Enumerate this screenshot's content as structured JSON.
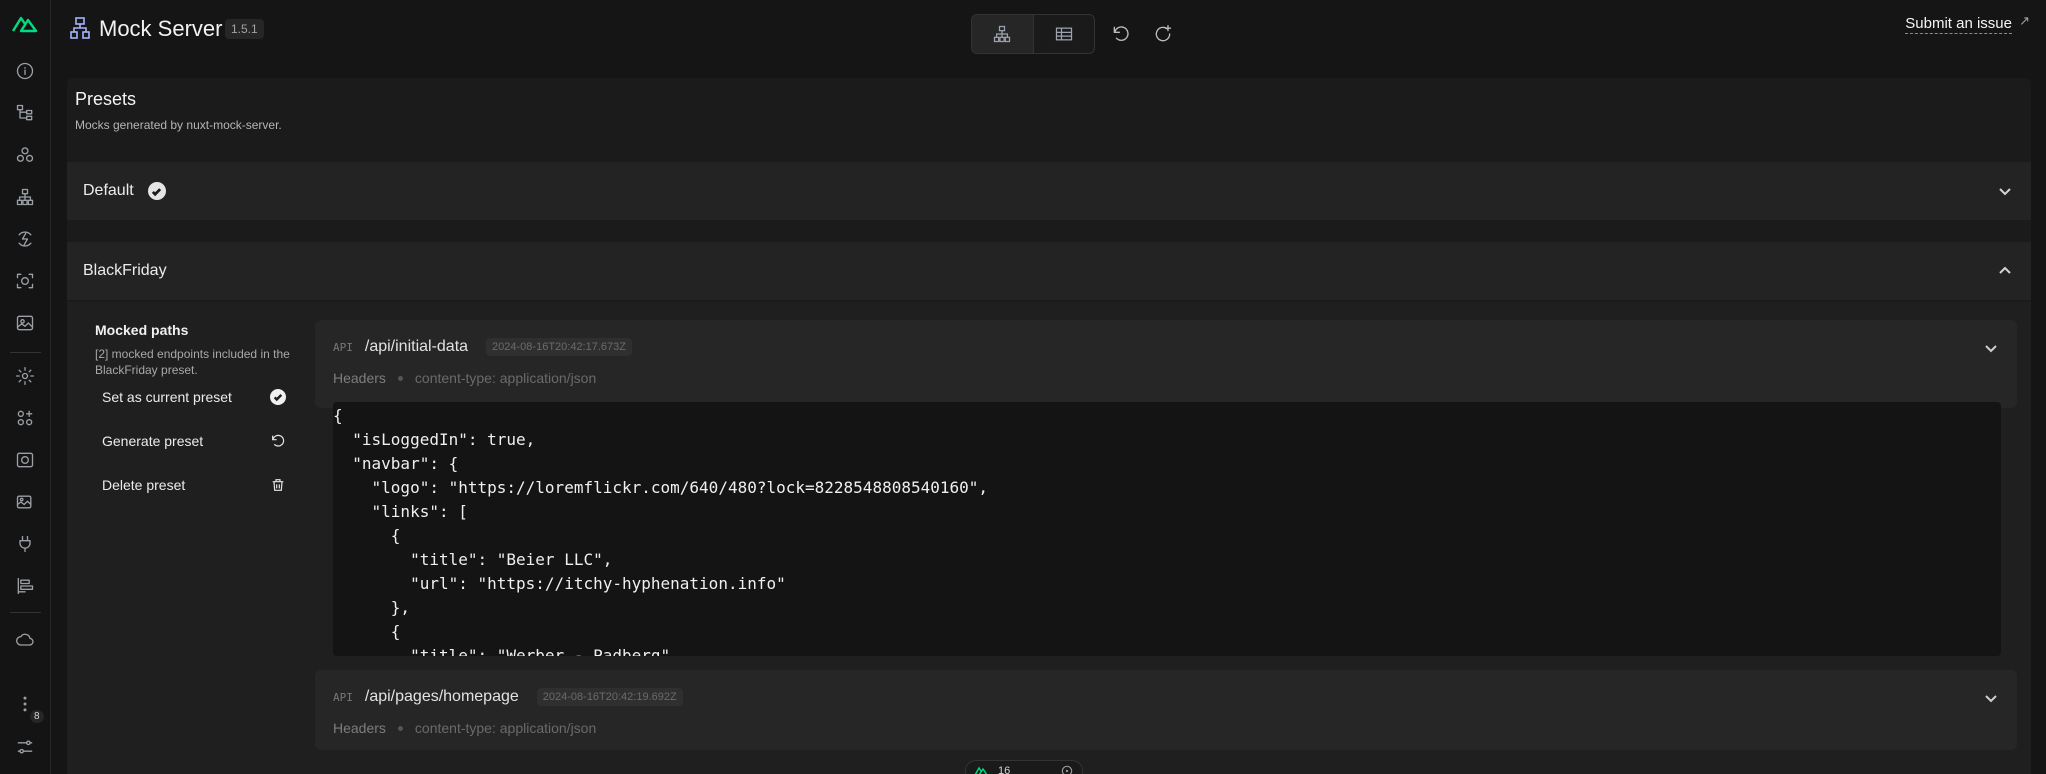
{
  "app": {
    "title": "Mock Server",
    "version": "1.5.1",
    "submit_issue_label": "Submit an issue",
    "brand_color": "#00dc82"
  },
  "sidebar": {
    "notification_count": "8"
  },
  "page": {
    "title": "Presets",
    "subtitle": "Mocks generated by nuxt-mock-server."
  },
  "presets": [
    {
      "name": "Default",
      "is_current": true,
      "expanded": false
    },
    {
      "name": "BlackFriday",
      "is_current": false,
      "expanded": true
    }
  ],
  "blackfriday": {
    "panel_title": "Mocked paths",
    "panel_desc": "[2] mocked endpoints included in the BlackFriday preset.",
    "actions": {
      "set_current": "Set as current preset",
      "generate": "Generate preset",
      "delete": "Delete preset"
    },
    "endpoints": [
      {
        "method": "API",
        "path": "/api/initial-data",
        "timestamp": "2024-08-16T20:42:17.673Z",
        "headers_label": "Headers",
        "header_value": "content-type: application/json"
      },
      {
        "method": "API",
        "path": "/api/pages/homepage",
        "timestamp": "2024-08-16T20:42:19.692Z",
        "headers_label": "Headers",
        "header_value": "content-type: application/json"
      }
    ],
    "code_lines": [
      "{",
      "  \"isLoggedIn\": true,",
      "  \"navbar\": {",
      "    \"logo\": \"https://loremflickr.com/640/480?lock=8228548808540160\",",
      "    \"links\": [",
      "      {",
      "        \"title\": \"Beier LLC\",",
      "        \"url\": \"https://itchy-hyphenation.info\"",
      "      },",
      "      {",
      "        \"title\": \"Werber - Padberg\","
    ]
  },
  "devtools": {
    "count": "16"
  }
}
